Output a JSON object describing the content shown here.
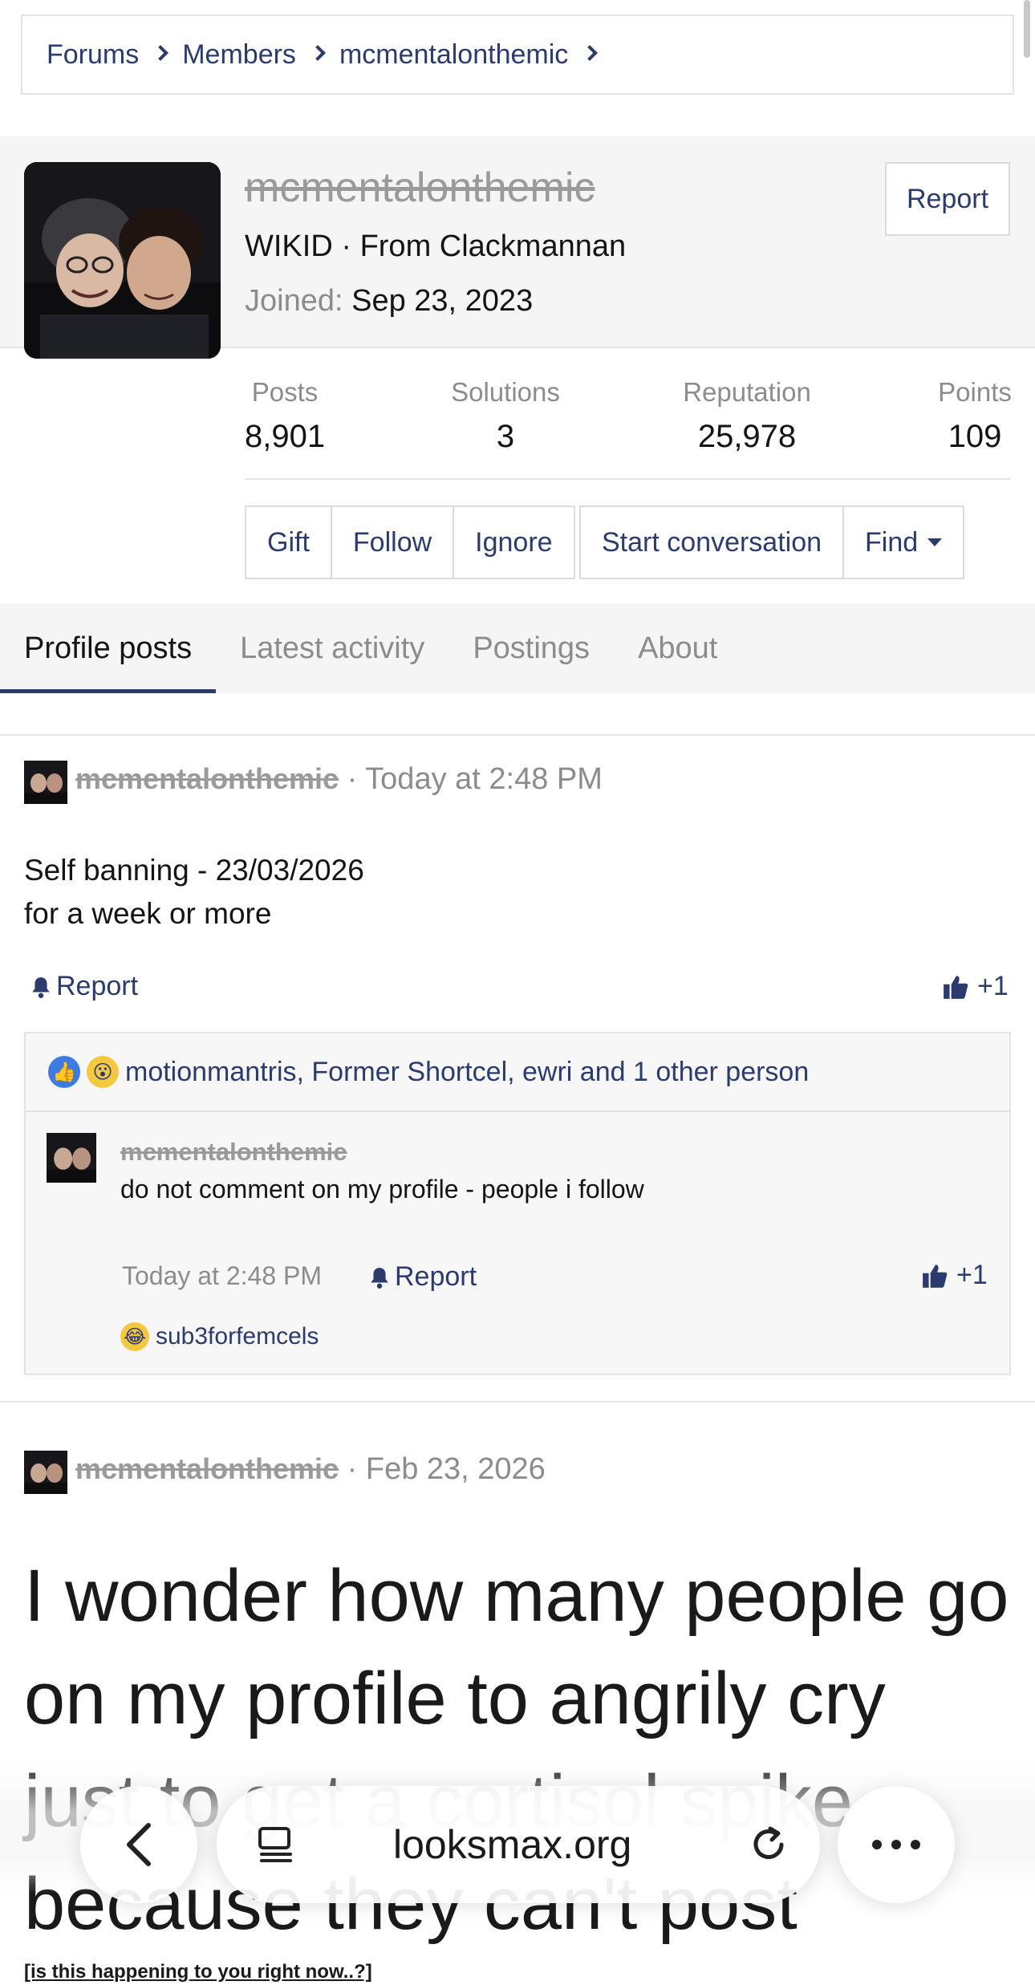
{
  "breadcrumb": {
    "items": [
      "Forums",
      "Members",
      "mcmentalonthemic"
    ]
  },
  "profile": {
    "username": "mcmentalonthemic",
    "title": "WIKID",
    "location": "From Clackmannan",
    "joined_label": "Joined:",
    "joined_date": "Sep 23, 2023",
    "report_label": "Report"
  },
  "stats": [
    {
      "label": "Posts",
      "value": "8,901"
    },
    {
      "label": "Solutions",
      "value": "3"
    },
    {
      "label": "Reputation",
      "value": "25,978"
    },
    {
      "label": "Points",
      "value": "109"
    }
  ],
  "actions": {
    "gift": "Gift",
    "follow": "Follow",
    "ignore": "Ignore",
    "start_conversation": "Start conversation",
    "find": "Find"
  },
  "tabs": [
    "Profile posts",
    "Latest activity",
    "Postings",
    "About"
  ],
  "posts": [
    {
      "author": "mcmentalonthemic",
      "time": "Today at 2:48 PM",
      "body_line1": "Self banning - 23/03/2026",
      "body_line2": "for a week or more",
      "report_label": "Report",
      "likes": "+1",
      "reactions_text": "motionmantris, Former Shortcel, ewri and 1 other person",
      "comment": {
        "author": "mcmentalonthemic",
        "text": "do not comment on my profile - people i follow",
        "time": "Today at 2:48 PM",
        "report_label": "Report",
        "likes": "+1",
        "reactor": "sub3forfemcels"
      }
    },
    {
      "author": "mcmentalonthemic",
      "time": "Feb 23, 2026",
      "body": "I wonder how many people go on my profile to angrily cry just to get a cortisol spike because they can't post",
      "footer_link": "[is this happening to you right now..?]"
    }
  ],
  "browser": {
    "url": "looksmax.org"
  },
  "colors": {
    "link": "#2b3b6e",
    "muted": "#8c8c8c",
    "band": "#f5f5f5"
  }
}
